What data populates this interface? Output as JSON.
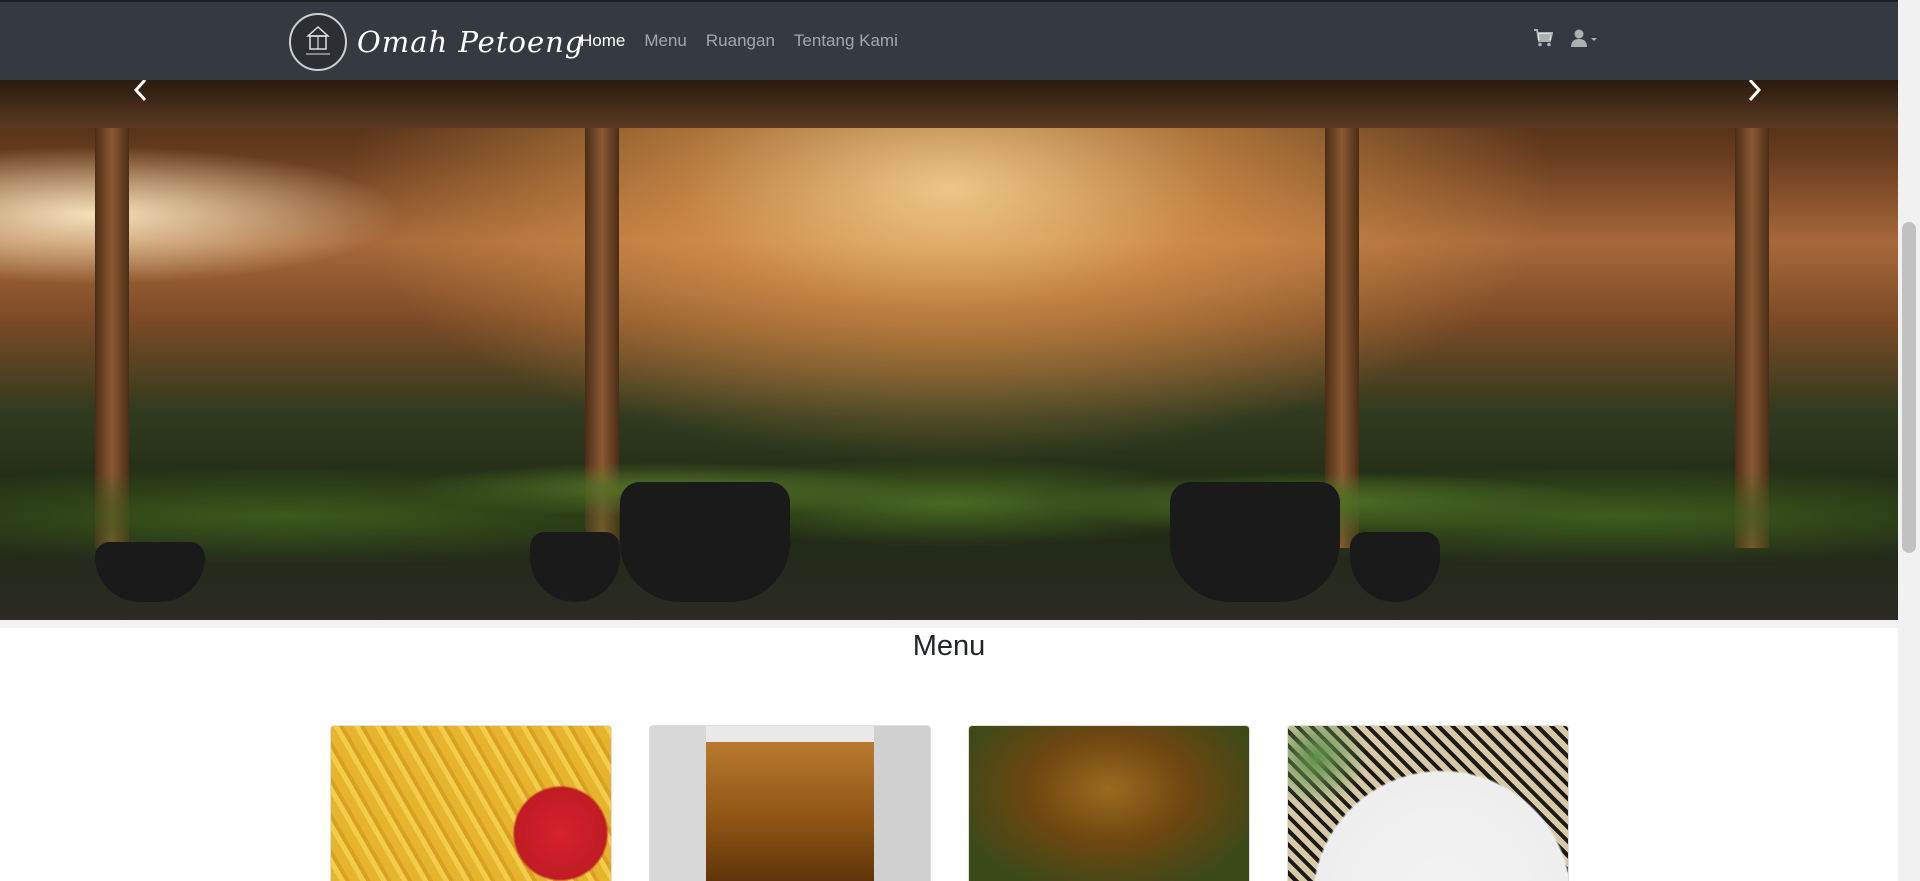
{
  "brand": {
    "name": "Omah Petoeng",
    "logo_icon": "omah-petoeng-logo"
  },
  "nav": {
    "items": [
      {
        "label": "Home",
        "active": true
      },
      {
        "label": "Menu",
        "active": false
      },
      {
        "label": "Ruangan",
        "active": false
      },
      {
        "label": "Tentang Kami",
        "active": false
      }
    ],
    "cart_icon": "cart-icon",
    "user_icon": "user-dropdown-icon"
  },
  "hero": {
    "image": "restaurant-pendopo-photo",
    "prev_icon": "chevron-left-icon",
    "next_icon": "chevron-right-icon"
  },
  "menu_section": {
    "title": "Menu",
    "cards": [
      {
        "image": "french-fries-photo"
      },
      {
        "image": "iced-tea-mug-photo"
      },
      {
        "image": "hot-tea-glass-photo"
      },
      {
        "image": "grilled-chicken-rice-photo"
      }
    ]
  },
  "colors": {
    "navbar": "#343a40",
    "nav_active": "#ffffff",
    "nav_inactive": "rgba(255,255,255,0.55)"
  }
}
